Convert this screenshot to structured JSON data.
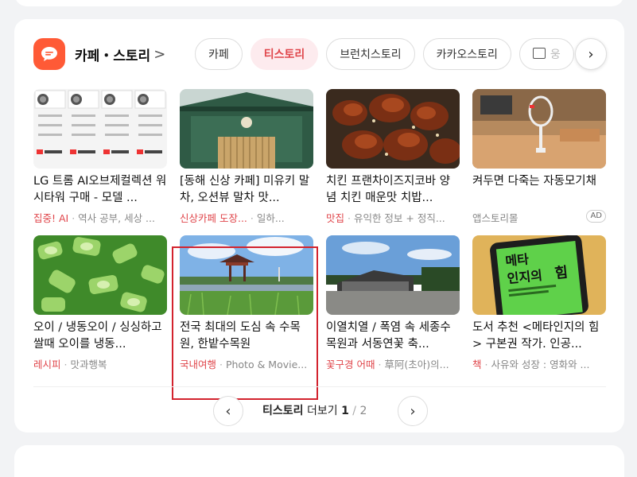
{
  "section": {
    "title": "카페・스토리",
    "chevron": ">"
  },
  "chips": [
    {
      "label": "카페",
      "active": false
    },
    {
      "label": "티스토리",
      "active": true
    },
    {
      "label": "브런치스토리",
      "active": false
    },
    {
      "label": "카카오스토리",
      "active": false
    },
    {
      "label": "웅",
      "active": false
    }
  ],
  "items": [
    {
      "title": "LG 트롬 AI오브제컬렉션 워시타워 구매 - 모델 ...",
      "tag": "집중! AI",
      "source": "역사 공부, 세상 ..."
    },
    {
      "title": "[동해 신상 카페] 미유키 말차, 오션뷰 말차 맛...",
      "tag": "신상카페 도장...",
      "source": "일하..."
    },
    {
      "title": "치킨 프랜차이즈지코바 양념 치킨 매운맛 치밥...",
      "tag": "맛집",
      "source": "유익한 정보 + 정직..."
    },
    {
      "title": "켜두면 다죽는 자동모기채",
      "tag": "",
      "source": "앱스토리몰",
      "ad": "AD"
    },
    {
      "title": "오이 / 냉동오이 / 싱싱하고 쌀때 오이를 냉동...",
      "tag": "레시피",
      "source": "맛과행복"
    },
    {
      "title": "전국 최대의 도심 속 수목원, 한밭수목원",
      "tag": "국내여행",
      "source": "Photo & Movie..."
    },
    {
      "title": "이열치열 / 폭염 속 세종수목원과 서동연꽃 축...",
      "tag": "꽃구경 어때",
      "source": "草阿(초아)의..."
    },
    {
      "title": "도서 추천 <메타인지의 힘> 구본권 작가. 인공...",
      "tag": "책",
      "source": "사유와 성장 : 영화와 ..."
    }
  ],
  "book_cover": {
    "line1": "메타",
    "line2": "인지의",
    "line3": "힘"
  },
  "pager": {
    "label": "티스토리",
    "more": "더보기",
    "current": "1",
    "slash": "/",
    "total": "2"
  },
  "colors": {
    "accent": "#e0464b",
    "brand_icon": "#ff5a36",
    "highlight": "#d3232e"
  }
}
